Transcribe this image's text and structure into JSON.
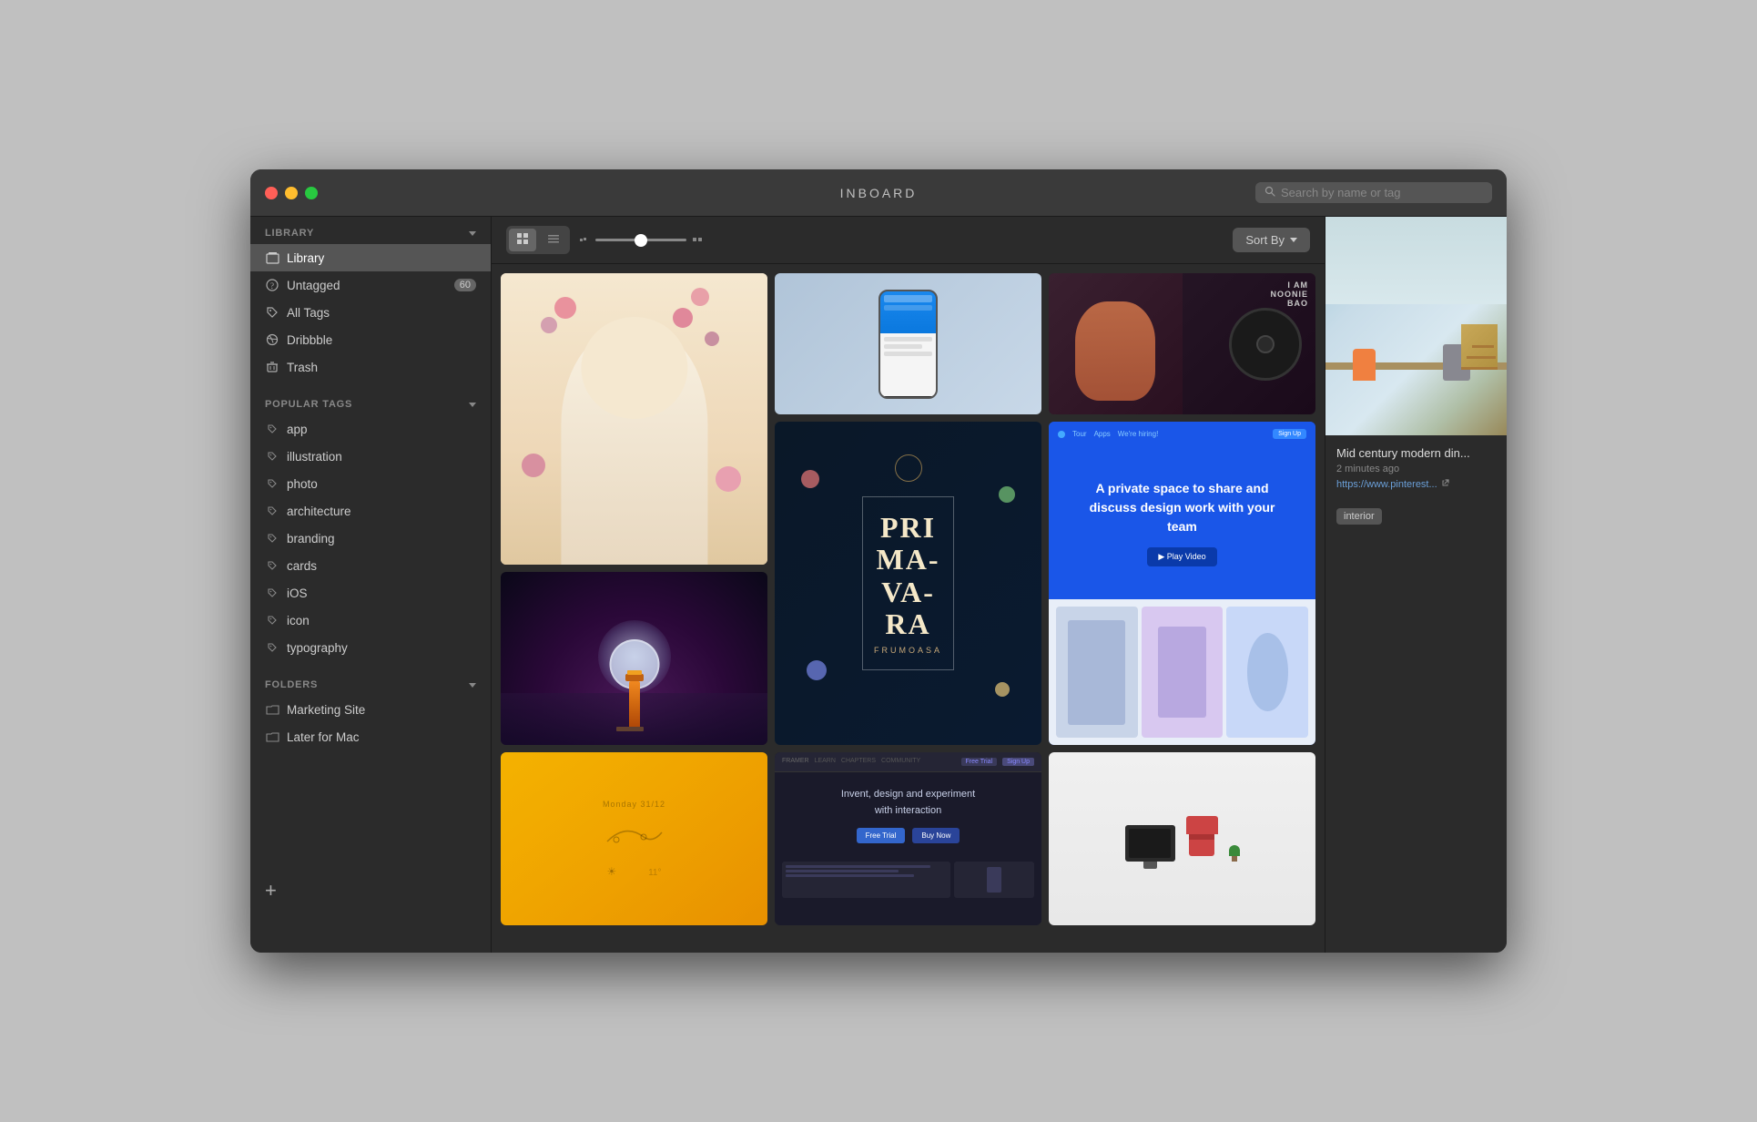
{
  "app": {
    "title": "INBOARD",
    "window_controls": {
      "close": "close",
      "minimize": "minimize",
      "maximize": "maximize"
    }
  },
  "titlebar": {
    "search_placeholder": "Search by name or tag"
  },
  "sidebar": {
    "library_header": "LIBRARY",
    "popular_tags_header": "POPULAR TAGS",
    "folders_header": "FOLDERS",
    "items": [
      {
        "id": "library",
        "label": "Library",
        "icon": "library-icon",
        "active": true
      },
      {
        "id": "untagged",
        "label": "Untagged",
        "icon": "question-icon",
        "badge": "60"
      },
      {
        "id": "all-tags",
        "label": "All Tags",
        "icon": "tag-icon"
      },
      {
        "id": "dribbble",
        "label": "Dribbble",
        "icon": "dribbble-icon"
      },
      {
        "id": "trash",
        "label": "Trash",
        "icon": "trash-icon"
      }
    ],
    "tags": [
      {
        "id": "app",
        "label": "app"
      },
      {
        "id": "illustration",
        "label": "illustration"
      },
      {
        "id": "photo",
        "label": "photo"
      },
      {
        "id": "architecture",
        "label": "architecture"
      },
      {
        "id": "branding",
        "label": "branding"
      },
      {
        "id": "cards",
        "label": "cards"
      },
      {
        "id": "ios",
        "label": "iOS"
      },
      {
        "id": "icon",
        "label": "icon"
      },
      {
        "id": "typography",
        "label": "typography"
      }
    ],
    "folders": [
      {
        "id": "marketing-site",
        "label": "Marketing Site"
      },
      {
        "id": "later-for-mac",
        "label": "Later for Mac"
      }
    ],
    "add_button": "+"
  },
  "toolbar": {
    "sort_label": "Sort By",
    "sort_icon": "chevron-down",
    "view_grid": "⊞",
    "view_list": "☰"
  },
  "gallery": {
    "items": [
      {
        "id": 1,
        "type": "flower-portrait",
        "alt": "Woman with flowers in hair"
      },
      {
        "id": 2,
        "type": "phone-mockup",
        "alt": "Phone app mockup"
      },
      {
        "id": 3,
        "type": "vinyl-record",
        "alt": "Vinyl record album art"
      },
      {
        "id": 4,
        "type": "primavara",
        "alt": "Primavara typography design"
      },
      {
        "id": 5,
        "type": "blue-website",
        "alt": "Blue team collaboration website"
      },
      {
        "id": 6,
        "type": "lighthouse",
        "alt": "Lighthouse at night illustration"
      },
      {
        "id": 7,
        "type": "yellow-card",
        "alt": "Yellow card design"
      },
      {
        "id": 8,
        "type": "framer",
        "alt": "Framer interaction design page"
      },
      {
        "id": 9,
        "type": "workspace",
        "alt": "Workspace product mockup"
      }
    ]
  },
  "detail_panel": {
    "title": "Mid century modern din...",
    "time": "2 minutes ago",
    "url": "https://www.pinterest...",
    "url_icon": "external-link-icon",
    "tags": [
      {
        "label": "interior"
      }
    ]
  }
}
